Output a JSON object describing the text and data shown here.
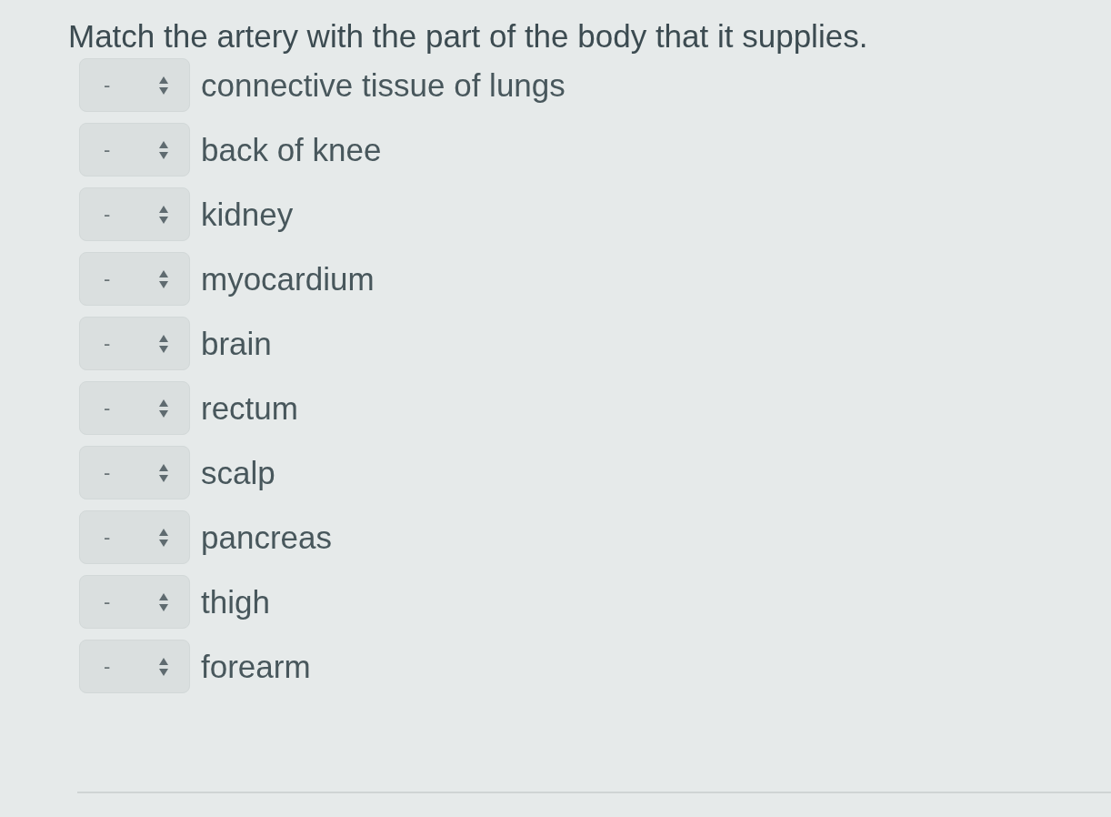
{
  "question": "Match the artery with the part of the body that it supplies.",
  "items": [
    {
      "value": "-",
      "label": "connective tissue of lungs"
    },
    {
      "value": "-",
      "label": "back of knee"
    },
    {
      "value": "-",
      "label": "kidney"
    },
    {
      "value": "-",
      "label": "myocardium"
    },
    {
      "value": "-",
      "label": "brain"
    },
    {
      "value": "-",
      "label": "rectum"
    },
    {
      "value": "-",
      "label": "scalp"
    },
    {
      "value": "-",
      "label": "pancreas"
    },
    {
      "value": "-",
      "label": "thigh"
    },
    {
      "value": "-",
      "label": "forearm"
    }
  ]
}
